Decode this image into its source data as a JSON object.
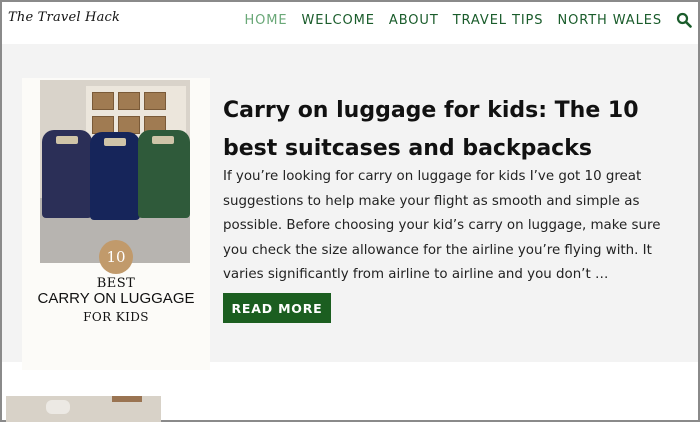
{
  "site": {
    "logo_text": "The Travel Hack"
  },
  "nav": {
    "items": [
      {
        "label": "HOME",
        "active": true
      },
      {
        "label": "WELCOME",
        "active": false
      },
      {
        "label": "ABOUT",
        "active": false
      },
      {
        "label": "TRAVEL TIPS",
        "active": false
      },
      {
        "label": "NORTH WALES",
        "active": false
      }
    ],
    "search_icon": "search-icon"
  },
  "post": {
    "title": "Carry on luggage for kids: The 10 best suitcases and backpacks",
    "excerpt": "If you’re looking for carry on luggage for kids I’ve got 10 great suggestions to help make your flight as smooth and simple as possible. Before choosing your kid’s carry on luggage, make sure you check the size allowance for the airline you’re flying with. It varies significantly from airline to airline and you don’t …",
    "read_more_label": "READ MORE",
    "thumbnail": {
      "badge_number": "10",
      "line1": "BEST",
      "line2": "CARRY ON LUGGAGE",
      "line3": "FOR KIDS"
    }
  },
  "colors": {
    "nav_text": "#1a5c2b",
    "nav_active": "#6aa878",
    "button_bg": "#1b5e20",
    "card_bg": "#f3f3f3"
  }
}
